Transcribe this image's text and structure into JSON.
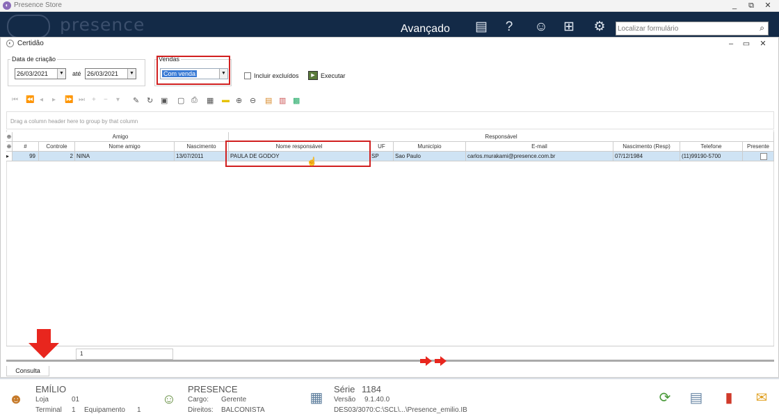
{
  "window": {
    "title": "Presence Store",
    "min": "_",
    "restore": "⧉",
    "close": "✕"
  },
  "header": {
    "logo_text": "presence",
    "mode_label": "Avançado",
    "icons": [
      "news-icon",
      "help-icon",
      "users-icon",
      "network-icon",
      "settings-icon"
    ],
    "search_placeholder": "Localizar formulário",
    "search_icon": "⌕"
  },
  "form": {
    "title": "Certidão",
    "win_min": "‒",
    "win_max": "▭",
    "win_close": "✕",
    "date_group_label": "Data de criação",
    "date_from": "26/03/2021",
    "date_sep": "até",
    "date_to": "26/03/2021",
    "sales_group_label": "Vendas",
    "sales_value": "Com venda",
    "include_deleted_label": "Incluir excluídos",
    "execute_label": "Executar"
  },
  "grid": {
    "group_panel_text": "Drag a column header here to group by that column",
    "band_amigo": "Amigo",
    "band_responsavel": "Responsável",
    "columns": [
      "#",
      "Controle",
      "Nome amigo",
      "Nascimento",
      "Nome responsável",
      "UF",
      "Município",
      "E-mail",
      "Nascimento (Resp)",
      "Telefone",
      "Presente"
    ],
    "rows": [
      [
        "99",
        "2",
        "NINA",
        "13/07/2011",
        "PAULA DE GODOY",
        "SP",
        "Sao Paulo",
        "carlos.murakami@presence.com.br",
        "07/12/1984",
        "(11)99190-5700",
        ""
      ]
    ],
    "footer_count": "1"
  },
  "tabs": {
    "consulta": "Consulta"
  },
  "status": {
    "user_name": "EMÍLIO",
    "loja_label": "Loja",
    "loja_value": "01",
    "terminal_label": "Terminal",
    "terminal_value": "1",
    "equip_label": "Equipamento",
    "equip_value": "1",
    "company": "PRESENCE",
    "cargo_label": "Cargo:",
    "cargo_value": "Gerente",
    "direitos_label": "Direitos:",
    "direitos_value": "BALCONISTA",
    "serie_label": "Série",
    "serie_value": "1184",
    "versao_label": "Versão",
    "versao_value": "9.1.40.0",
    "db_path": "DES03/3070:C:\\SCL\\...\\Presence_emilio.IB"
  },
  "colors": {
    "header_bg": "#132a47",
    "highlight": "#d11f1f",
    "selected_row": "#cfe3f4"
  }
}
